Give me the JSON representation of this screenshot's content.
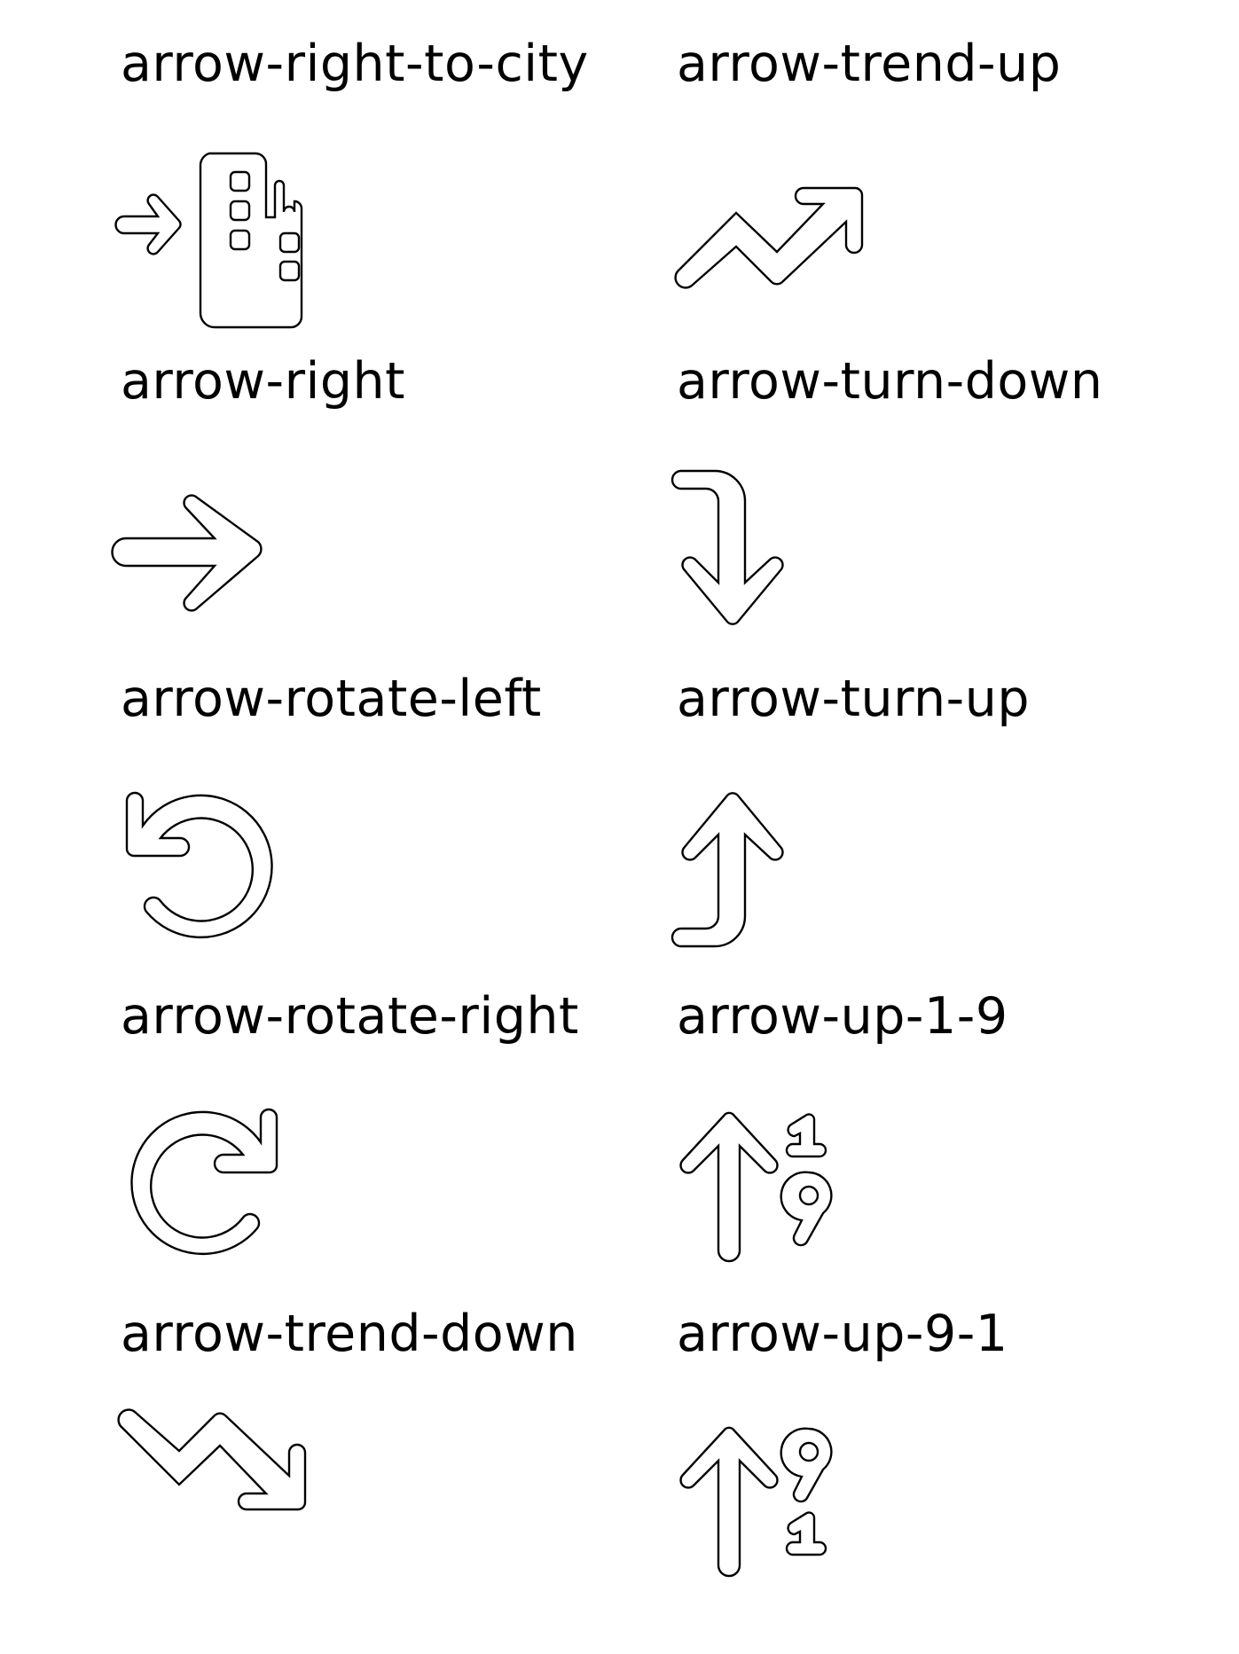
{
  "icons": [
    {
      "name": "arrow-right-to-city"
    },
    {
      "name": "arrow-trend-up"
    },
    {
      "name": "arrow-right"
    },
    {
      "name": "arrow-turn-down"
    },
    {
      "name": "arrow-rotate-left"
    },
    {
      "name": "arrow-turn-up"
    },
    {
      "name": "arrow-rotate-right"
    },
    {
      "name": "arrow-up-1-9"
    },
    {
      "name": "arrow-trend-down"
    },
    {
      "name": "arrow-up-9-1"
    }
  ]
}
